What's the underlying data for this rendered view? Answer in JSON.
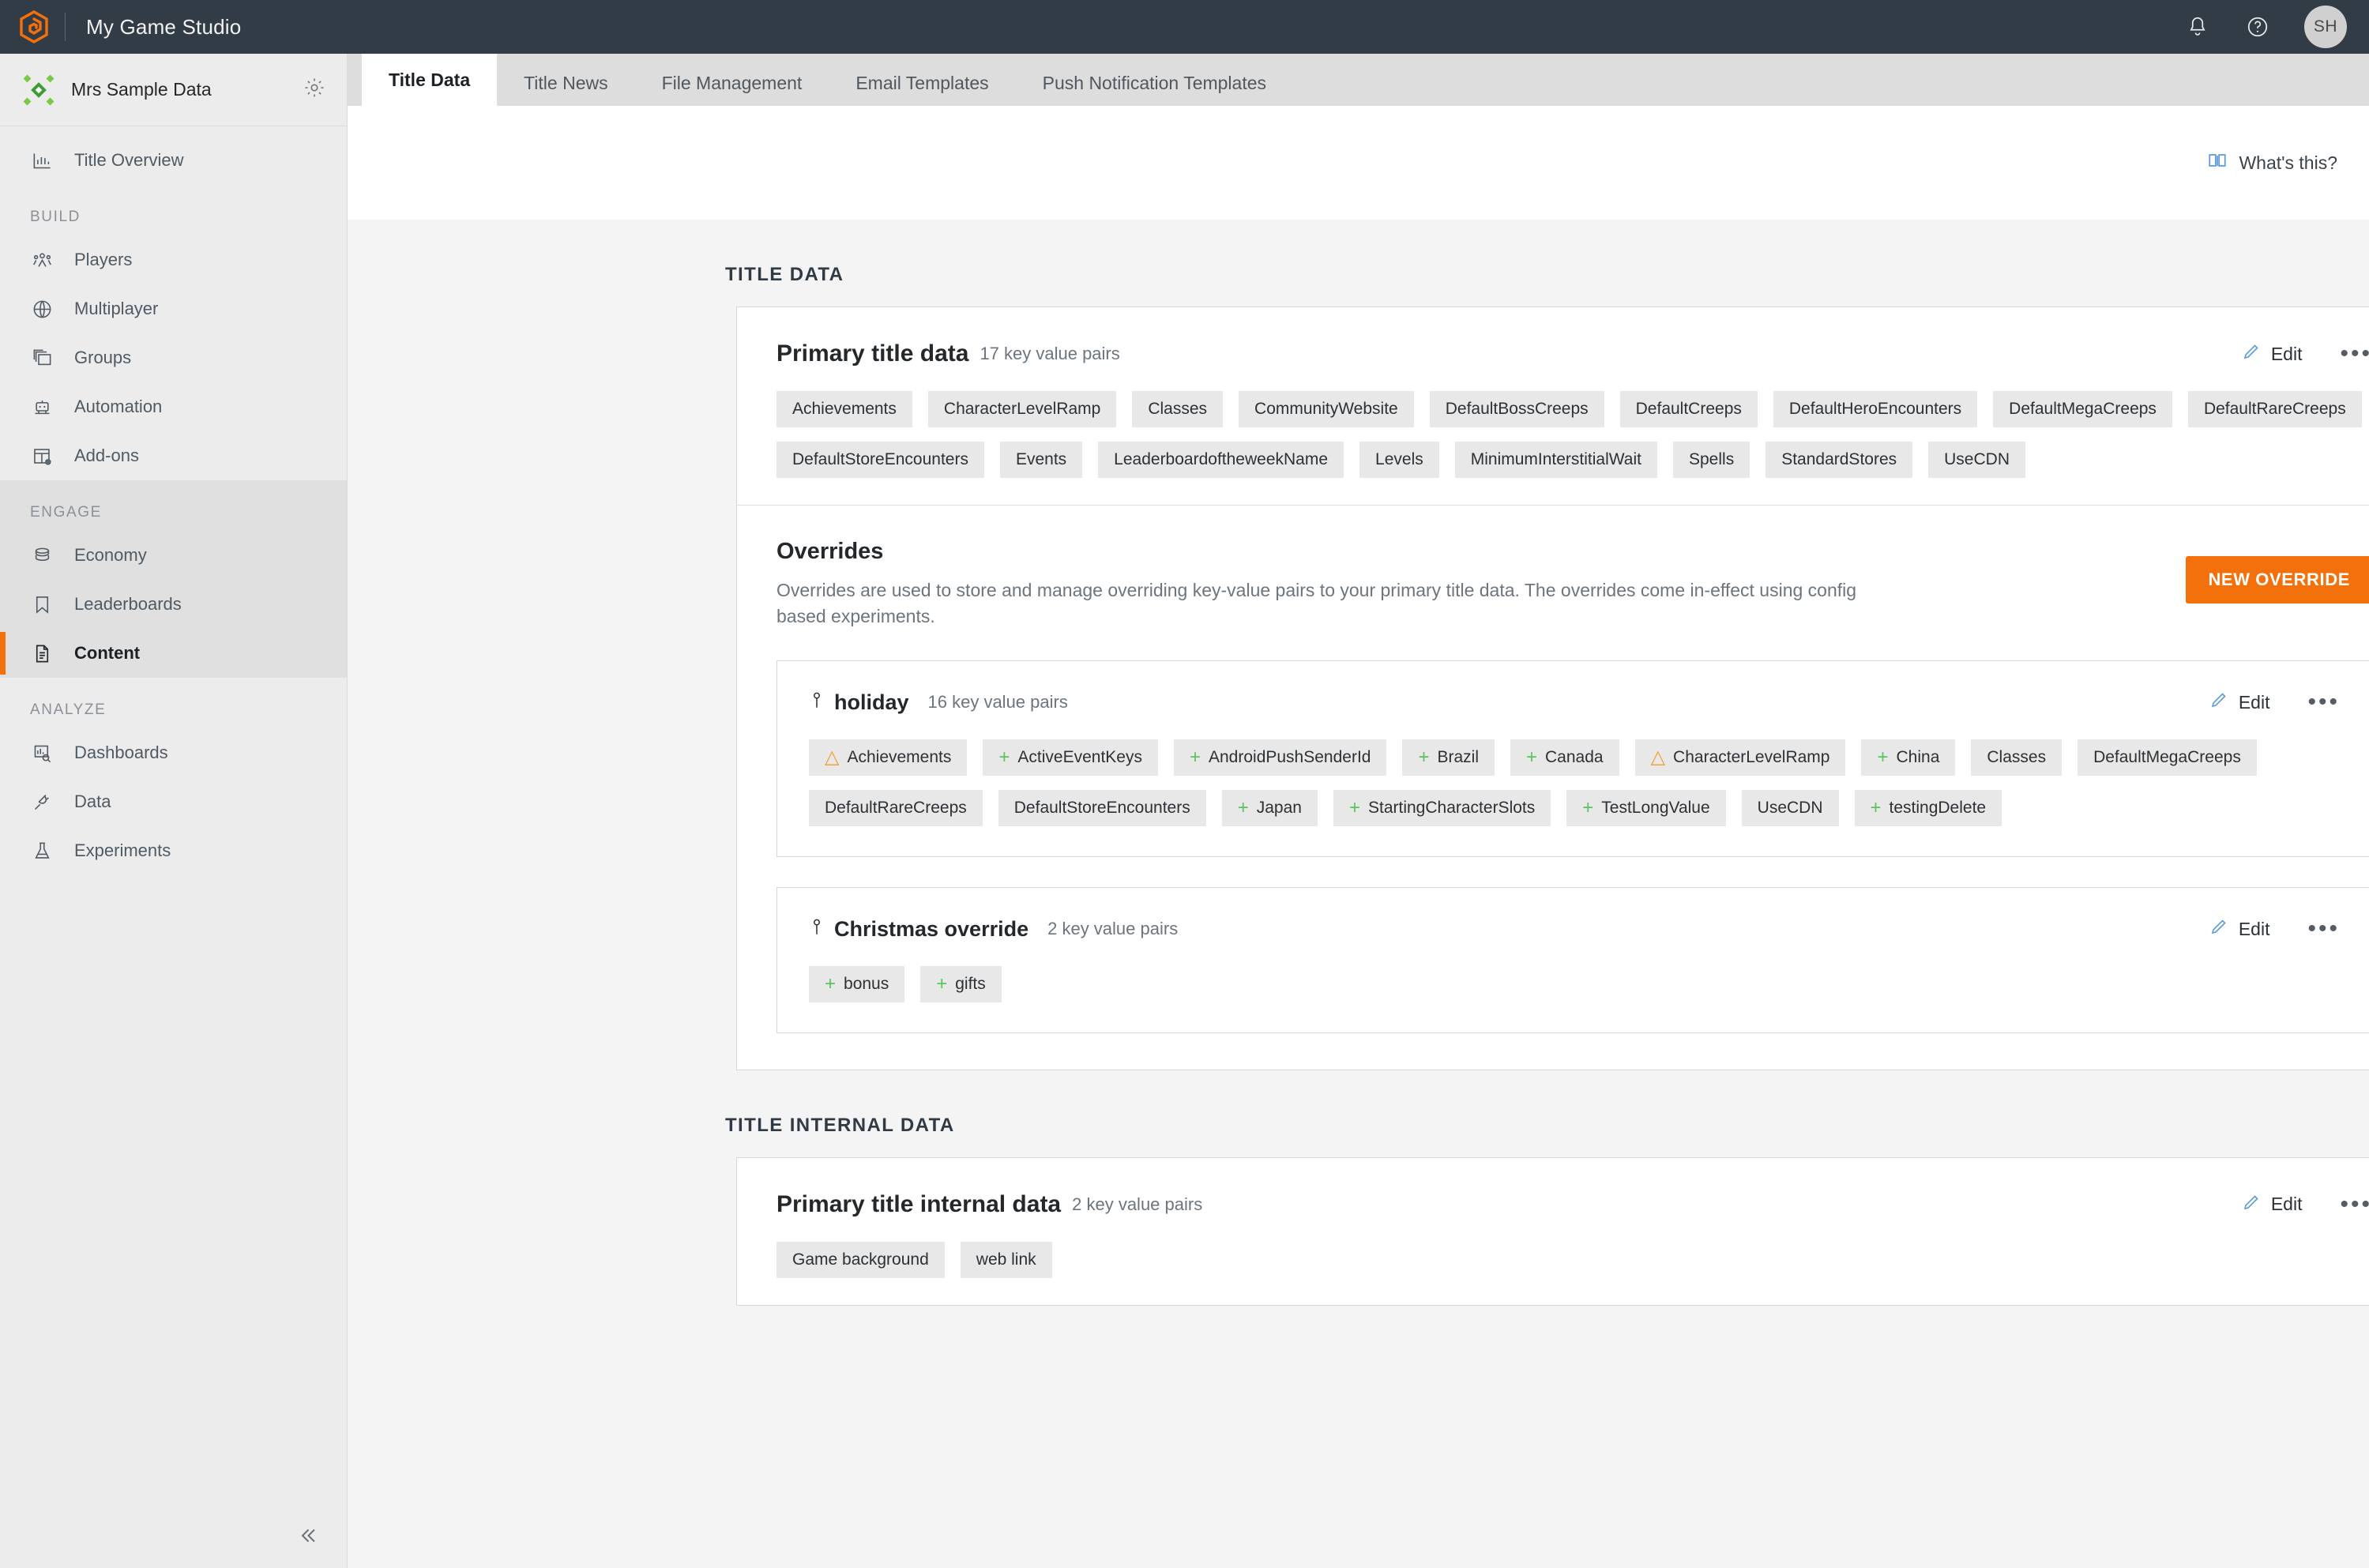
{
  "topbar": {
    "title": "My Game Studio",
    "logo_icon": "playfab-hex-logo",
    "notifications_icon": "bell-icon",
    "help_icon": "question-circle-icon",
    "avatar_initials": "SH",
    "accent_color": "#f4700a",
    "background_color": "#323c46"
  },
  "sidebar": {
    "studio_name": "Mrs Sample Data",
    "studio_logo_icon": "green-diamond-icon",
    "settings_icon": "gear-icon",
    "collapse_icon": "chevron-double-left-icon",
    "overview": {
      "label": "Title Overview",
      "icon": "bar-chart-icon"
    },
    "groups": [
      {
        "header": "BUILD",
        "items": [
          {
            "label": "Players",
            "icon": "people-icon",
            "active": false
          },
          {
            "label": "Multiplayer",
            "icon": "globe-icon",
            "active": false
          },
          {
            "label": "Groups",
            "icon": "stacked-squares-icon",
            "active": false
          },
          {
            "label": "Automation",
            "icon": "robot-icon",
            "active": false
          },
          {
            "label": "Add-ons",
            "icon": "table-gear-icon",
            "active": false
          }
        ]
      },
      {
        "header": "ENGAGE",
        "items": [
          {
            "label": "Economy",
            "icon": "coins-stack-icon",
            "active": false
          },
          {
            "label": "Leaderboards",
            "icon": "bookmark-icon",
            "active": false
          },
          {
            "label": "Content",
            "icon": "document-lines-icon",
            "active": true
          }
        ]
      },
      {
        "header": "ANALYZE",
        "items": [
          {
            "label": "Dashboards",
            "icon": "chart-search-icon",
            "active": false
          },
          {
            "label": "Data",
            "icon": "plug-icon",
            "active": false
          },
          {
            "label": "Experiments",
            "icon": "flask-icon",
            "active": false
          }
        ]
      }
    ]
  },
  "tabs": [
    {
      "label": "Title Data",
      "active": true
    },
    {
      "label": "Title News",
      "active": false
    },
    {
      "label": "File Management",
      "active": false
    },
    {
      "label": "Email Templates",
      "active": false
    },
    {
      "label": "Push Notification Templates",
      "active": false
    }
  ],
  "whats_this": {
    "label": "What's this?",
    "icon": "book-icon",
    "color": "#5b9bd5"
  },
  "title_data": {
    "section_heading": "TITLE DATA",
    "primary": {
      "title": "Primary title data",
      "count_label": "17 key value pairs",
      "edit_label": "Edit",
      "edit_icon": "pencil-icon",
      "more_icon": "ellipsis-icon",
      "keys": [
        {
          "name": "Achievements",
          "marker": "none"
        },
        {
          "name": "CharacterLevelRamp",
          "marker": "none"
        },
        {
          "name": "Classes",
          "marker": "none"
        },
        {
          "name": "CommunityWebsite",
          "marker": "none"
        },
        {
          "name": "DefaultBossCreeps",
          "marker": "none"
        },
        {
          "name": "DefaultCreeps",
          "marker": "none"
        },
        {
          "name": "DefaultHeroEncounters",
          "marker": "none"
        },
        {
          "name": "DefaultMegaCreeps",
          "marker": "none"
        },
        {
          "name": "DefaultRareCreeps",
          "marker": "none"
        },
        {
          "name": "DefaultStoreEncounters",
          "marker": "none"
        },
        {
          "name": "Events",
          "marker": "none"
        },
        {
          "name": "LeaderboardoftheweekName",
          "marker": "none"
        },
        {
          "name": "Levels",
          "marker": "none"
        },
        {
          "name": "MinimumInterstitialWait",
          "marker": "none"
        },
        {
          "name": "Spells",
          "marker": "none"
        },
        {
          "name": "StandardStores",
          "marker": "none"
        },
        {
          "name": "UseCDN",
          "marker": "none"
        }
      ]
    },
    "overrides": {
      "title": "Overrides",
      "description": "Overrides are used to store and manage overriding key-value pairs to your primary title data. The overrides come in-effect using config based experiments.",
      "new_button": "NEW OVERRIDE",
      "items": [
        {
          "name": "holiday",
          "name_icon": "branch-icon",
          "count_label": "16 key value pairs",
          "edit_label": "Edit",
          "edit_icon": "pencil-icon",
          "more_icon": "ellipsis-icon",
          "keys": [
            {
              "name": "Achievements",
              "marker": "warning"
            },
            {
              "name": "ActiveEventKeys",
              "marker": "add"
            },
            {
              "name": "AndroidPushSenderId",
              "marker": "add"
            },
            {
              "name": "Brazil",
              "marker": "add"
            },
            {
              "name": "Canada",
              "marker": "add"
            },
            {
              "name": "CharacterLevelRamp",
              "marker": "warning"
            },
            {
              "name": "China",
              "marker": "add"
            },
            {
              "name": "Classes",
              "marker": "none"
            },
            {
              "name": "DefaultMegaCreeps",
              "marker": "none"
            },
            {
              "name": "DefaultRareCreeps",
              "marker": "none"
            },
            {
              "name": "DefaultStoreEncounters",
              "marker": "none"
            },
            {
              "name": "Japan",
              "marker": "add"
            },
            {
              "name": "StartingCharacterSlots",
              "marker": "add"
            },
            {
              "name": "TestLongValue",
              "marker": "add"
            },
            {
              "name": "UseCDN",
              "marker": "none"
            },
            {
              "name": "testingDelete",
              "marker": "add"
            }
          ]
        },
        {
          "name": "Christmas override",
          "name_icon": "branch-icon",
          "count_label": "2 key value pairs",
          "edit_label": "Edit",
          "edit_icon": "pencil-icon",
          "more_icon": "ellipsis-icon",
          "keys": [
            {
              "name": "bonus",
              "marker": "add"
            },
            {
              "name": "gifts",
              "marker": "add"
            }
          ]
        }
      ]
    }
  },
  "title_internal_data": {
    "section_heading": "TITLE INTERNAL DATA",
    "primary": {
      "title": "Primary title internal data",
      "count_label": "2 key value pairs",
      "edit_label": "Edit",
      "edit_icon": "pencil-icon",
      "more_icon": "ellipsis-icon",
      "keys": [
        {
          "name": "Game background",
          "marker": "none"
        },
        {
          "name": "web link",
          "marker": "none"
        }
      ]
    }
  },
  "markers": {
    "add_glyph": "+",
    "warning_glyph": "△",
    "add_color": "#5cc45c",
    "warning_color": "#f0a033"
  }
}
